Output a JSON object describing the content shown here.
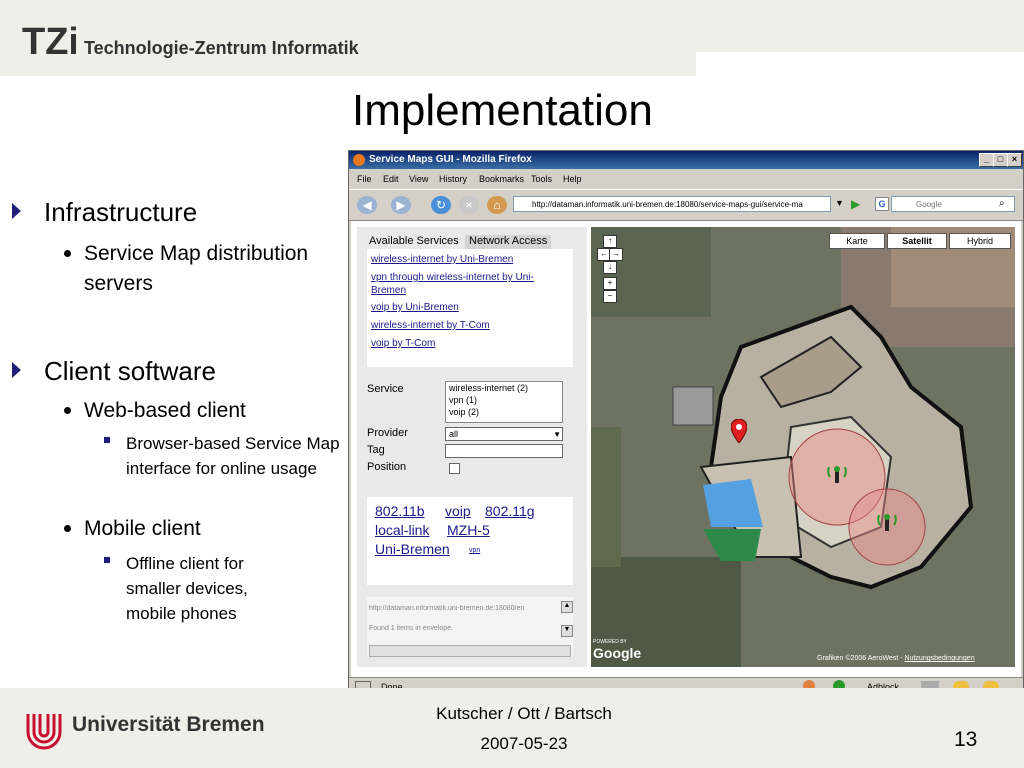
{
  "header": {
    "org_name": "Technologie-Zentrum Informatik",
    "logo_text": "TZi"
  },
  "slide": {
    "title": "Implementation",
    "bullets": [
      {
        "label": "Infrastructure",
        "sub": [
          {
            "label": "Service Map distribution servers"
          }
        ]
      },
      {
        "label": "Client software",
        "sub": [
          {
            "label": "Web-based client",
            "sub": [
              "Browser-based Service Map interface for online usage"
            ]
          },
          {
            "label": "Mobile client",
            "sub": [
              "Offline client for smaller devices, mobile phones"
            ]
          }
        ]
      }
    ]
  },
  "browser": {
    "window_title": "Service Maps GUI - Mozilla Firefox",
    "menu": [
      "File",
      "Edit",
      "View",
      "History",
      "Bookmarks",
      "Tools",
      "Help"
    ],
    "url": "http://dataman.informatik.uni-bremen.de:18080/service-maps-gui/service-ma",
    "search_placeholder": "Google",
    "status_text": "Done",
    "status_adblock": "Adblock"
  },
  "app": {
    "tabs": [
      "Available Services",
      "Network Access"
    ],
    "services": [
      "wireless-internet by Uni-Bremen",
      "vpn through wireless-internet by Uni-Bremen",
      "voip by Uni-Bremen",
      "wireless-internet by T-Com",
      "voip by T-Com"
    ],
    "labels": {
      "service": "Service",
      "provider": "Provider",
      "tag": "Tag",
      "position": "Position"
    },
    "service_options": [
      "wireless-internet (2)",
      "vpn (1)",
      "voip (2)"
    ],
    "provider_value": "all",
    "tag_cloud": [
      "802.11b",
      "voip",
      "802.11g",
      "local-link",
      "MZH-5",
      "Uni-Bremen",
      "vpn"
    ],
    "status_url": "http://dataman.informatik.uni-bremen.de:18080/en",
    "status_found": "Found 1 items in envelope.",
    "map_types": [
      "Karte",
      "Satellit",
      "Hybrid"
    ],
    "map_zoom_buttons": [
      "↑",
      "←",
      "→",
      "↓",
      "+",
      "−"
    ],
    "map_powered": "POWERED BY",
    "map_brand": "Google",
    "map_copyright": "Grafiken ©2006 AeroWest -",
    "map_terms": "Nutzungsbedingungen"
  },
  "footer": {
    "university": "Universität Bremen",
    "authors": "Kutscher / Ott / Bartsch",
    "date": "2007-05-23",
    "page_number": "13"
  }
}
